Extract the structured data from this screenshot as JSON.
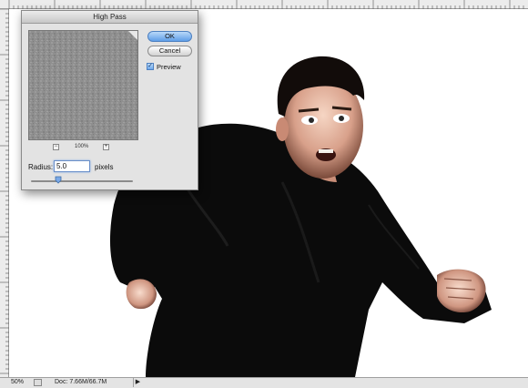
{
  "dialog": {
    "title": "High Pass",
    "ok_label": "OK",
    "cancel_label": "Cancel",
    "preview_label": "Preview",
    "preview_checked": true,
    "zoom_minus": "−",
    "zoom_plus": "+",
    "zoom_percent": "100%",
    "radius_label": "Radius:",
    "radius_value": "5.0",
    "radius_unit": "pixels"
  },
  "statusbar": {
    "zoom": "50%",
    "doc_info": "Doc: 7.66M/66.7M",
    "arrow": "▶"
  },
  "colors": {
    "ok_accent": "#5f9ee8",
    "dialog_bg": "#e3e3e3",
    "preview_gray": "#8e8e8e"
  }
}
